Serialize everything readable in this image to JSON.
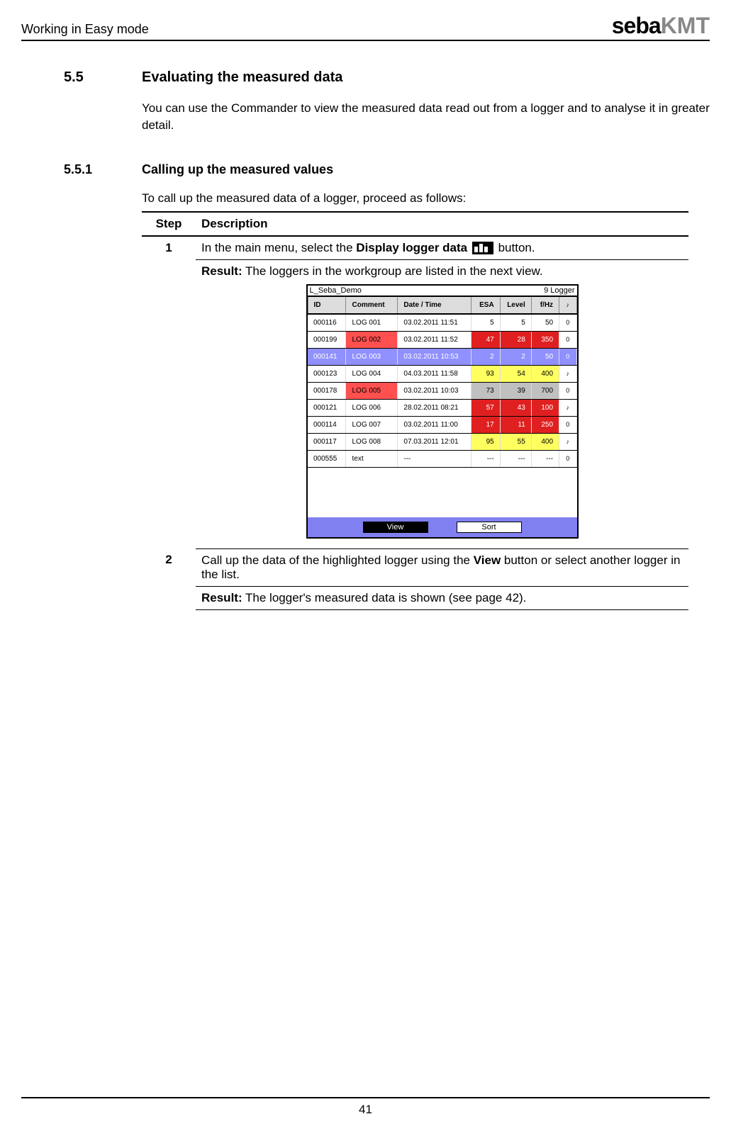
{
  "header": {
    "title": "Working in Easy mode",
    "logo_main": "seba",
    "logo_sub": "KMT"
  },
  "section": {
    "num": "5.5",
    "title": "Evaluating the measured data",
    "body": "You can use the Commander to view the measured data read out from a logger and to analyse it in greater detail."
  },
  "subsection": {
    "num": "5.5.1",
    "title": "Calling up the measured values",
    "intro": "To call up the measured data of a logger, proceed as follows:"
  },
  "table": {
    "head_step": "Step",
    "head_desc": "Description",
    "step1": {
      "num": "1",
      "line_before": "In the main menu, select the ",
      "bold": "Display logger data",
      "line_after": " button.",
      "result_label": "Result:",
      "result_text": " The loggers in the workgroup are listed in the next view."
    },
    "step2": {
      "num": "2",
      "line_before": "Call up the data of the highlighted logger using the ",
      "bold": "View",
      "line_after": " button or select another logger in the list.",
      "result_label": "Result:",
      "result_text": " The logger's measured data is shown (see page 42)."
    }
  },
  "device": {
    "title": "L_Seba_Demo",
    "count": "9 Logger",
    "headers": [
      "ID",
      "Comment",
      "Date / Time",
      "ESA",
      "Level",
      "f/Hz",
      "♪"
    ],
    "rows": [
      {
        "id": "000116",
        "com": "LOG 001",
        "dt": "03.02.2011  11:51",
        "esa": "5",
        "lvl": "5",
        "fhz": "50",
        "ico": "0",
        "com_red": false,
        "val_style": "plain"
      },
      {
        "id": "000199",
        "com": "LOG 002",
        "dt": "03.02.2011  11:52",
        "esa": "47",
        "lvl": "28",
        "fhz": "350",
        "ico": "0",
        "com_red": true,
        "val_style": "red"
      },
      {
        "id": "000141",
        "com": "LOG 003",
        "dt": "03.02.2011  10:53",
        "esa": "2",
        "lvl": "2",
        "fhz": "50",
        "ico": "0",
        "com_red": true,
        "val_style": "sel"
      },
      {
        "id": "000123",
        "com": "LOG 004",
        "dt": "04.03.2011  11:58",
        "esa": "93",
        "lvl": "54",
        "fhz": "400",
        "ico": "♪",
        "com_red": false,
        "val_style": "yellow"
      },
      {
        "id": "000178",
        "com": "LOG 005",
        "dt": "03.02.2011  10:03",
        "esa": "73",
        "lvl": "39",
        "fhz": "700",
        "ico": "0",
        "com_red": true,
        "val_style": "gray"
      },
      {
        "id": "000121",
        "com": "LOG 006",
        "dt": "28.02.2011  08:21",
        "esa": "57",
        "lvl": "43",
        "fhz": "100",
        "ico": "♪",
        "com_red": false,
        "val_style": "red"
      },
      {
        "id": "000114",
        "com": "LOG 007",
        "dt": "03.02.2011  11:00",
        "esa": "17",
        "lvl": "11",
        "fhz": "250",
        "ico": "0",
        "com_red": false,
        "val_style": "red"
      },
      {
        "id": "000117",
        "com": "LOG 008",
        "dt": "07.03.2011  12:01",
        "esa": "95",
        "lvl": "55",
        "fhz": "400",
        "ico": "♪",
        "com_red": false,
        "val_style": "yellow"
      },
      {
        "id": "000555",
        "com": "text",
        "dt": "---",
        "esa": "---",
        "lvl": "---",
        "fhz": "---",
        "ico": "0",
        "com_red": false,
        "val_style": "plain"
      }
    ],
    "btn_view": "View",
    "btn_sort": "Sort"
  },
  "page_number": "41"
}
